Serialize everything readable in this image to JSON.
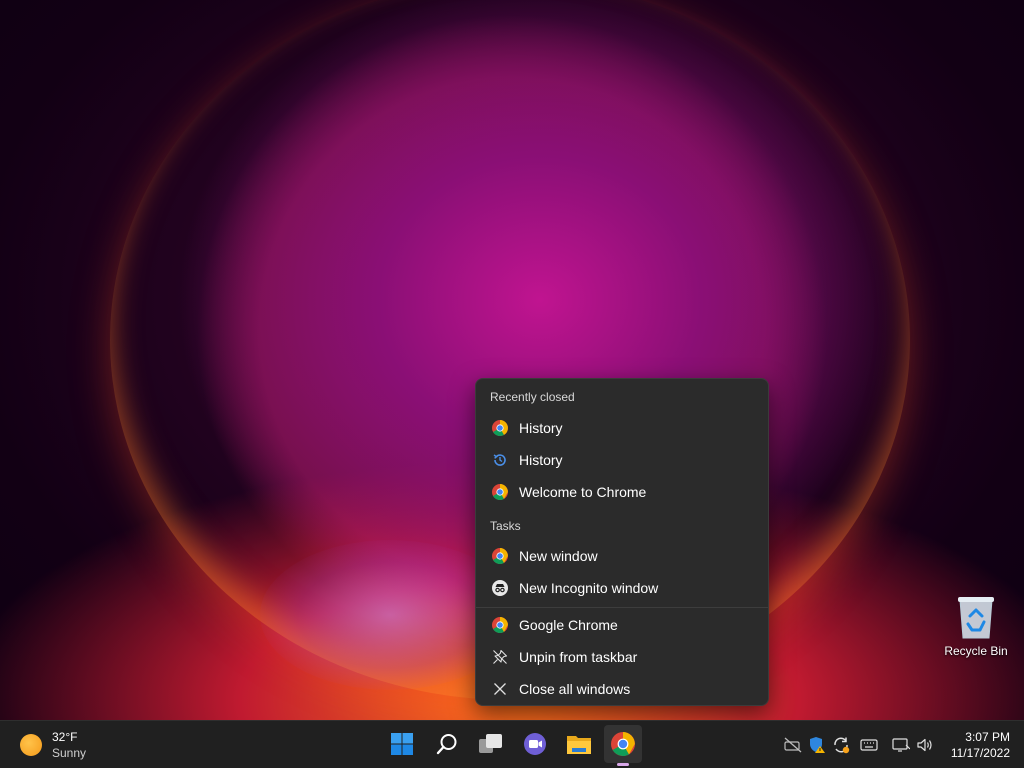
{
  "desktop": {
    "recycle_bin_label": "Recycle Bin"
  },
  "jumplist": {
    "recently_closed_header": "Recently closed",
    "recently_closed": [
      {
        "label": "History",
        "icon": "chrome-icon"
      },
      {
        "label": "History",
        "icon": "history-icon"
      },
      {
        "label": "Welcome to Chrome",
        "icon": "chrome-icon"
      }
    ],
    "tasks_header": "Tasks",
    "tasks": [
      {
        "label": "New window",
        "icon": "chrome-icon"
      },
      {
        "label": "New Incognito window",
        "icon": "incognito-icon"
      }
    ],
    "app_actions": [
      {
        "label": "Google Chrome",
        "icon": "chrome-icon"
      },
      {
        "label": "Unpin from taskbar",
        "icon": "unpin-icon"
      },
      {
        "label": "Close all windows",
        "icon": "close-icon"
      }
    ]
  },
  "taskbar": {
    "weather": {
      "temp": "32°F",
      "condition": "Sunny"
    },
    "apps": [
      "start-icon",
      "search-icon",
      "task-view-icon",
      "teams-chat-icon",
      "file-explorer-icon",
      "chrome-icon"
    ],
    "clock": {
      "time": "3:07 PM",
      "date": "11/17/2022"
    }
  },
  "colors": {
    "menu_bg": "#2b2b2b",
    "taskbar_bg": "#202020",
    "accent": "#0078d4"
  }
}
